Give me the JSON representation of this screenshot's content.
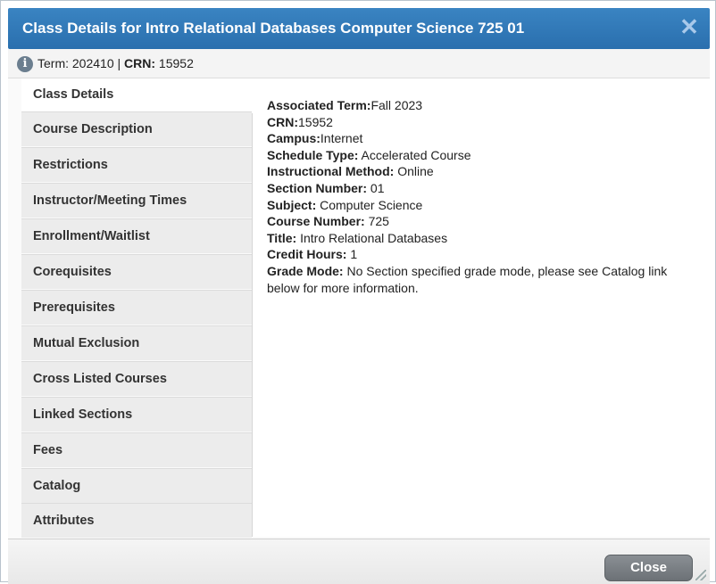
{
  "dialog": {
    "title": "Class Details for Intro Relational Databases Computer Science 725 01",
    "close_glyph": "✕",
    "term_label": "Term:",
    "term_value": "202410",
    "separator": "|",
    "crn_label": "CRN:",
    "crn_value": "15952",
    "info_glyph": "i"
  },
  "sidebar": {
    "tabs": [
      {
        "label": "Class Details"
      },
      {
        "label": "Course Description"
      },
      {
        "label": "Restrictions"
      },
      {
        "label": "Instructor/Meeting Times"
      },
      {
        "label": "Enrollment/Waitlist"
      },
      {
        "label": "Corequisites"
      },
      {
        "label": "Prerequisites"
      },
      {
        "label": "Mutual Exclusion"
      },
      {
        "label": "Cross Listed Courses"
      },
      {
        "label": "Linked Sections"
      },
      {
        "label": "Fees"
      },
      {
        "label": "Catalog"
      },
      {
        "label": "Attributes"
      }
    ]
  },
  "details": [
    {
      "label": "Associated Term:",
      "value": "Fall 2023"
    },
    {
      "label": "CRN:",
      "value": "15952"
    },
    {
      "label": "Campus:",
      "value": "Internet"
    },
    {
      "label": "Schedule Type:",
      "value": " Accelerated Course"
    },
    {
      "label": "Instructional Method:",
      "value": " Online"
    },
    {
      "label": "Section Number:",
      "value": " 01"
    },
    {
      "label": "Subject:",
      "value": " Computer Science"
    },
    {
      "label": "Course Number:",
      "value": " 725"
    },
    {
      "label": "Title:",
      "value": " Intro Relational Databases"
    },
    {
      "label": "Credit Hours:",
      "value": " 1"
    },
    {
      "label": "Grade Mode:",
      "value": " No Section specified grade mode, please see Catalog link below for more information."
    }
  ],
  "footer": {
    "close_label": "Close"
  }
}
